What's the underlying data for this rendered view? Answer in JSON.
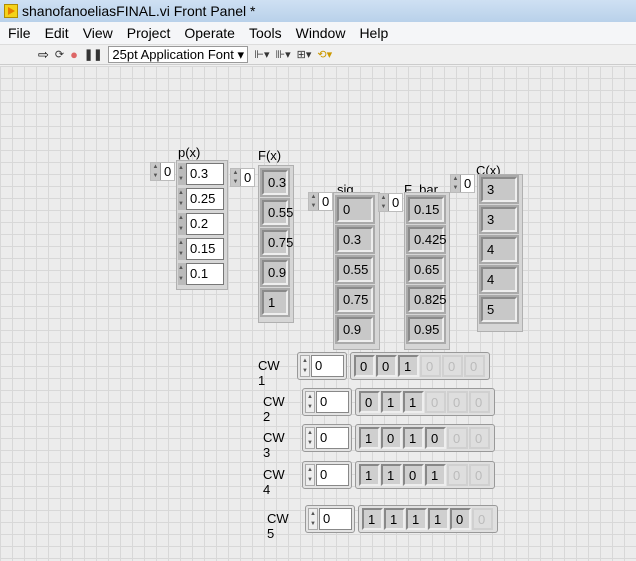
{
  "window": {
    "title": "shanofanoeliasFINAL.vi Front Panel *"
  },
  "menu": [
    "File",
    "Edit",
    "View",
    "Project",
    "Operate",
    "Tools",
    "Window",
    "Help"
  ],
  "toolbar": {
    "font": "25pt Application Font"
  },
  "arrays": [
    {
      "label": "p(x)",
      "index": "0",
      "kind": "control",
      "values": [
        "0.3",
        "0.25",
        "0.2",
        "0.15",
        "0.1"
      ]
    },
    {
      "label": "F(x)",
      "index": "0",
      "kind": "indicator",
      "values": [
        "0.3",
        "0.55",
        "0.75",
        "0.9",
        "1"
      ]
    },
    {
      "label": "sig",
      "index": "0",
      "kind": "indicator",
      "values": [
        "0",
        "0.3",
        "0.55",
        "0.75",
        "0.9"
      ]
    },
    {
      "label": "F_bar",
      "index": "0",
      "kind": "indicator",
      "values": [
        "0.15",
        "0.425",
        "0.65",
        "0.825",
        "0.95"
      ]
    },
    {
      "label": "C(x)",
      "index": "0",
      "kind": "indicator",
      "values": [
        "3",
        "3",
        "4",
        "4",
        "5"
      ]
    }
  ],
  "codewords": [
    {
      "label": "CW 1",
      "index": "0",
      "bits": [
        "0",
        "0",
        "1",
        "0",
        "0",
        "0"
      ],
      "active": 3
    },
    {
      "label": "CW 2",
      "index": "0",
      "bits": [
        "0",
        "1",
        "1",
        "0",
        "0",
        "0"
      ],
      "active": 3
    },
    {
      "label": "CW 3",
      "index": "0",
      "bits": [
        "1",
        "0",
        "1",
        "0",
        "0",
        "0"
      ],
      "active": 4
    },
    {
      "label": "CW 4",
      "index": "0",
      "bits": [
        "1",
        "1",
        "0",
        "1",
        "0",
        "0"
      ],
      "active": 4
    },
    {
      "label": "CW 5",
      "index": "0",
      "bits": [
        "1",
        "1",
        "1",
        "1",
        "0",
        "0"
      ],
      "active": 5
    }
  ]
}
